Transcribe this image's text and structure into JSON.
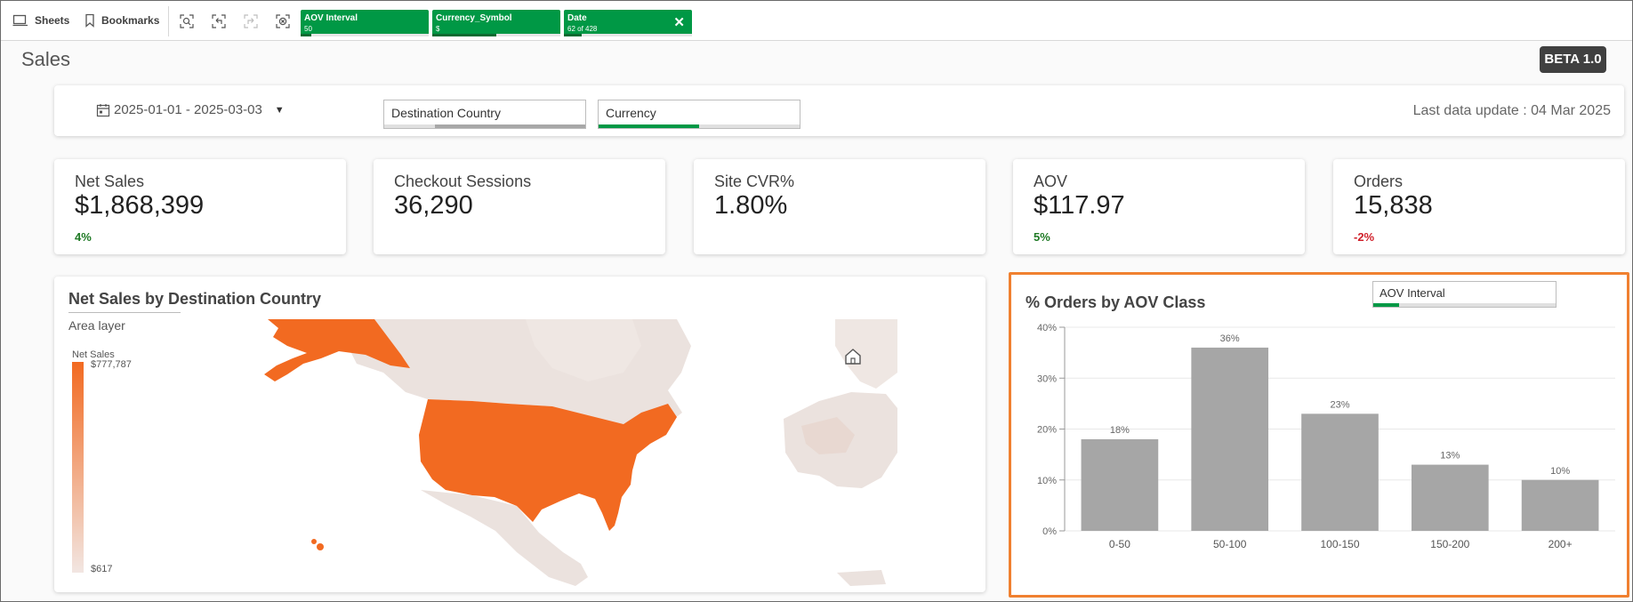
{
  "toolbar": {
    "sheets_label": "Sheets",
    "bookmarks_label": "Bookmarks",
    "selection_tools": [
      "smart-search-icon",
      "step-back-icon",
      "step-forward-icon",
      "clear-selections-icon"
    ]
  },
  "selections": [
    {
      "field": "AOV Interval",
      "value": "50",
      "fill": 0.08
    },
    {
      "field": "Currency_Symbol",
      "value": "$",
      "fill": 0.5
    },
    {
      "field": "Date",
      "value": "62 of 428",
      "fill": 0.14,
      "closable": true,
      "close_glyph": "✕"
    }
  ],
  "page": {
    "title": "Sales",
    "beta_badge": "BETA 1.0"
  },
  "filters": {
    "date_range": "2025-01-01 - 2025-03-03",
    "destination_country": {
      "label": "Destination Country",
      "fill": 0.75,
      "color": "#a8a8a8"
    },
    "currency": {
      "label": "Currency",
      "fill": 0.5,
      "color": "#009845"
    },
    "last_update": "Last data update :  04 Mar 2025"
  },
  "kpis": [
    {
      "label": "Net Sales",
      "value": "$1,868,399",
      "delta": "4%",
      "trend": "positive"
    },
    {
      "label": "Checkout Sessions",
      "value": "36,290",
      "delta": "",
      "trend": ""
    },
    {
      "label": "Site CVR%",
      "value": "1.80%",
      "delta": "",
      "trend": ""
    },
    {
      "label": "AOV",
      "value": "$117.97",
      "delta": "5%",
      "trend": "positive"
    },
    {
      "label": "Orders",
      "value": "15,838",
      "delta": "-2%",
      "trend": "negative"
    }
  ],
  "map_panel": {
    "title": "Net Sales by Destination Country",
    "layer_label": "Area layer",
    "measure_label": "Net Sales",
    "legend_max": "$777,787",
    "legend_min": "$617",
    "colors": {
      "high": "#f26a21",
      "low": "#efe6e2",
      "land": "#ebe2de"
    }
  },
  "bar_panel": {
    "title": "% Orders by AOV Class",
    "dropdown_label": "AOV Interval",
    "highlight_border": "#f08030"
  },
  "chart_data": {
    "type": "bar",
    "title": "% Orders by AOV Class",
    "categories": [
      "0-50",
      "50-100",
      "100-150",
      "150-200",
      "200+"
    ],
    "values": [
      18,
      36,
      23,
      13,
      10
    ],
    "value_labels": [
      "18%",
      "36%",
      "23%",
      "13%",
      "10%"
    ],
    "y_ticks": [
      "0%",
      "10%",
      "20%",
      "30%",
      "40%"
    ],
    "ylim": [
      0,
      40
    ],
    "xlabel": "",
    "ylabel": "",
    "grid": true,
    "bar_color": "#a6a6a6"
  }
}
